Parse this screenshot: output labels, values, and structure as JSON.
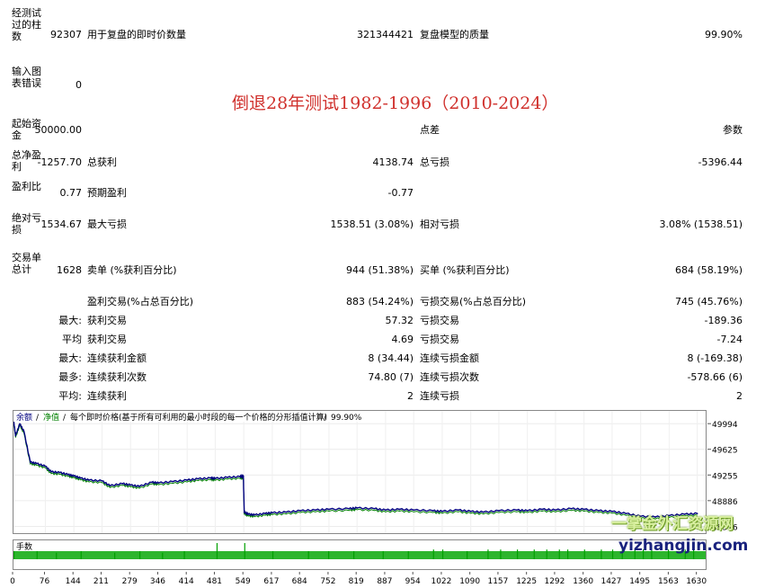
{
  "report": {
    "bars_label": "经测试过的柱数",
    "bars_value": "92307",
    "ticks_label": "用于复盘的即时价数量",
    "ticks_value": "321344421",
    "quality_label": "复盘模型的质量",
    "quality_value": "99.90%",
    "errors_label": "输入图表错误",
    "errors_value": "0",
    "deposit_label": "起始资金",
    "deposit_value": "50000.00",
    "spread_label": "点差",
    "params_label": "参数",
    "net_label": "总净盈利",
    "net_value": "-1257.70",
    "gross_profit_label": "总获利",
    "gross_profit_value": "4138.74",
    "gross_loss_label": "总亏损",
    "gross_loss_value": "-5396.44",
    "pf_label": "盈利比",
    "pf_value": "0.77",
    "expected_label": "预期盈利",
    "expected_value": "-0.77",
    "abs_dd_label": "绝对亏损",
    "abs_dd_value": "1534.67",
    "max_dd_label": "最大亏损",
    "max_dd_value": "1538.51 (3.08%)",
    "rel_dd_label": "相对亏损",
    "rel_dd_value": "3.08% (1538.51)",
    "trades_label": "交易单总计",
    "trades_value": "1628",
    "short_label": "卖单 (%获利百分比)",
    "short_value": "944 (51.38%)",
    "long_label": "买单 (%获利百分比)",
    "long_value": "684 (58.19%)",
    "profit_trades_label": "盈利交易(%占总百分比)",
    "profit_trades_value": "883 (54.24%)",
    "loss_trades_label": "亏损交易(%占总百分比)",
    "loss_trades_value": "745 (45.76%)",
    "largest_prefix": "最大:",
    "largest_profit_label": "获利交易",
    "largest_profit_value": "57.32",
    "largest_loss_label": "亏损交易",
    "largest_loss_value": "-189.36",
    "average_prefix": "平均",
    "avg_profit_label": "获利交易",
    "avg_profit_value": "4.69",
    "avg_loss_label": "亏损交易",
    "avg_loss_value": "-7.24",
    "max_prefix": "最大:",
    "max_cons_wins_label": "连续获利金额",
    "max_cons_wins_value": "8 (34.44)",
    "max_cons_losses_label": "连续亏损金额",
    "max_cons_losses_value": "8 (-169.38)",
    "maximal_prefix": "最多:",
    "maximal_cons_profit_label": "连续获利次数",
    "maximal_cons_profit_value": "74.80 (7)",
    "maximal_cons_loss_label": "连续亏损次数",
    "maximal_cons_loss_value": "-578.66 (6)",
    "avg2_prefix": "平均:",
    "avg_cons_wins_label": "连续获利",
    "avg_cons_wins_value": "2",
    "avg_cons_losses_label": "连续亏损",
    "avg_cons_losses_value": "2"
  },
  "overlay_title": "倒退28年测试1982-1996（2010-2024）",
  "chart_legend": {
    "balance": "余额",
    "equity": "净值",
    "description": "每个即时价格(基于所有可利用的最小时段的每一个价格的分形插值计算)",
    "quality": "99.90%"
  },
  "volume_label": "手数",
  "watermark_cn": "一掌金外汇资源网",
  "watermark_url": "yizhangjin.com",
  "colors": {
    "balance": "#00007f",
    "equity": "#008000",
    "volume": "#00a000",
    "title": "#d0312d"
  },
  "chart_data": {
    "type": "line",
    "x_ticks": [
      "0",
      "76",
      "144",
      "211",
      "279",
      "346",
      "414",
      "481",
      "549",
      "617",
      "684",
      "752",
      "819",
      "887",
      "954",
      "1022",
      "1090",
      "1157",
      "1225",
      "1292",
      "1360",
      "1427",
      "1495",
      "1563",
      "1630"
    ],
    "y_ticks": [
      "49994",
      "49625",
      "49255",
      "48886",
      "48516"
    ],
    "ylim": [
      48470,
      50100
    ],
    "xlim": [
      0,
      1650
    ],
    "series": [
      {
        "name": "余额",
        "x": [
          0,
          5,
          15,
          25,
          40,
          55,
          76,
          90,
          110,
          130,
          144,
          160,
          180,
          211,
          230,
          260,
          279,
          300,
          330,
          346,
          380,
          414,
          440,
          470,
          481,
          510,
          540,
          548,
          550,
          560,
          575,
          600,
          617,
          650,
          684,
          720,
          752,
          800,
          819,
          860,
          887,
          920,
          954,
          1000,
          1022,
          1060,
          1090,
          1120,
          1157,
          1200,
          1225,
          1260,
          1292,
          1330,
          1360,
          1395,
          1427,
          1460,
          1495,
          1530,
          1563,
          1600,
          1630
        ],
        "y": [
          50050,
          49820,
          49990,
          49880,
          49440,
          49420,
          49380,
          49300,
          49290,
          49260,
          49240,
          49210,
          49180,
          49170,
          49100,
          49130,
          49110,
          49090,
          49150,
          49140,
          49160,
          49180,
          49200,
          49210,
          49205,
          49220,
          49230,
          49240,
          48720,
          48690,
          48680,
          48700,
          48710,
          48720,
          48740,
          48750,
          48760,
          48770,
          48780,
          48770,
          48750,
          48760,
          48750,
          48740,
          48730,
          48750,
          48730,
          48720,
          48740,
          48750,
          48740,
          48760,
          48750,
          48770,
          48760,
          48740,
          48730,
          48700,
          48660,
          48650,
          48670,
          48690,
          48700
        ]
      }
    ],
    "volume_x": [
      0,
      55,
      101,
      160,
      240,
      300,
      354,
      406,
      484,
      550,
      617,
      702,
      750,
      810,
      880,
      940,
      1000,
      1022,
      1080,
      1130,
      1160,
      1200,
      1240,
      1270,
      1300,
      1320,
      1360,
      1400,
      1427,
      1450,
      1480,
      1500,
      1520,
      1560,
      1600,
      1620
    ],
    "volume_v": [
      0.5,
      0.5,
      0.4,
      0.5,
      0.4,
      0.5,
      0.4,
      0.5,
      1.0,
      1.0,
      0.5,
      0.5,
      0.5,
      0.5,
      0.5,
      0.5,
      0.6,
      0.6,
      0.5,
      0.6,
      0.6,
      0.6,
      0.6,
      0.6,
      0.6,
      0.6,
      0.6,
      0.6,
      0.6,
      0.6,
      0.6,
      0.6,
      0.6,
      0.6,
      0.6,
      0.6
    ]
  }
}
